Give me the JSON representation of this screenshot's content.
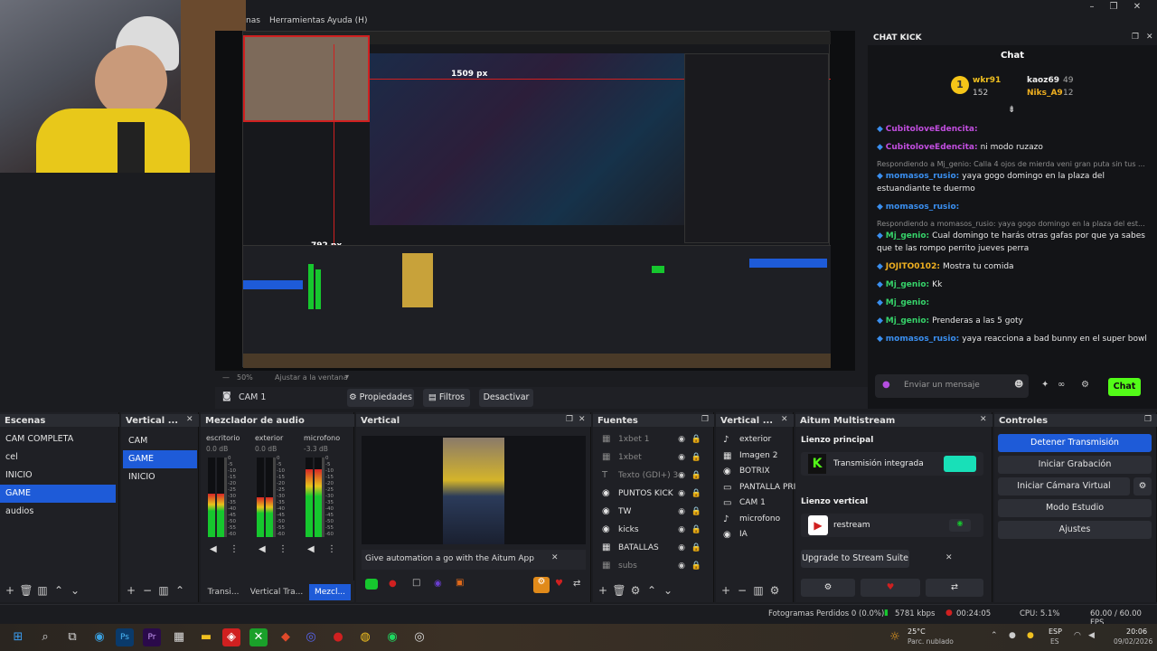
{
  "menu": {
    "items": [
      "nas",
      "Herramientas",
      "Ayuda (H)"
    ]
  },
  "preview": {
    "size_label_1": "1509 px",
    "size_label_2": "792 px",
    "zoom": "50%",
    "fit_label": "Ajustar a la ventana"
  },
  "source_toolbar": {
    "source_name": "CAM 1",
    "properties": "Propiedades",
    "filters": "Filtros",
    "deactivate": "Desactivar"
  },
  "chat": {
    "panel_title": "CHAT KICK",
    "header": "Chat",
    "leaderboard": [
      {
        "name": "wkr91",
        "count": "152"
      },
      {
        "name": "kaoz69",
        "count": "49"
      },
      {
        "name": "Niks_A9",
        "count": "12"
      }
    ],
    "messages": [
      {
        "user": "CubitoloveEdencita:",
        "text": "",
        "user_color": "#c24ee0"
      },
      {
        "user": "CubitoloveEdencita:",
        "text": "ni modo ruzazo",
        "user_color": "#c24ee0"
      },
      {
        "reply": "Respondiendo a Mj_genio: Calla 4 ojos de mierda veni gran puta sin tus ..."
      },
      {
        "user": "momasos_rusio:",
        "text": "yaya gogo domingo en la plaza del estuandiante te duermo",
        "user_color": "#3a8ff0"
      },
      {
        "user": "momasos_rusio:",
        "text": "",
        "user_color": "#3a8ff0"
      },
      {
        "reply": "Respondiendo a momasos_rusio: yaya gogo domingo en la plaza del est..."
      },
      {
        "user": "Mj_genio:",
        "text": "Cual domingo te harás otras gafas por que ya sabes que te las rompo perrito jueves perra",
        "user_color": "#36d36a"
      },
      {
        "user": "JOJITO0102:",
        "text": "Mostra tu comida",
        "user_color": "#f0b020"
      },
      {
        "user": "Mj_genio:",
        "text": "Kk",
        "user_color": "#36d36a"
      },
      {
        "user": "Mj_genio:",
        "text": "",
        "user_color": "#36d36a"
      },
      {
        "user": "Mj_genio:",
        "text": "Prenderas a las 5 goty",
        "user_color": "#36d36a"
      },
      {
        "user": "momasos_rusio:",
        "text": "yaya reacciona a bad bunny en el super bowl",
        "user_color": "#3a8ff0"
      }
    ],
    "input_placeholder": "Enviar un mensaje",
    "send_label": "Chat"
  },
  "scenes": {
    "title": "Escenas",
    "items": [
      "CAM COMPLETA",
      "cel",
      "INICIO",
      "GAME",
      "audios"
    ],
    "selected": 3
  },
  "vertical_scenes": {
    "title": "Vertical ...",
    "items": [
      "CAM",
      "GAME",
      "INICIO"
    ],
    "selected": 1
  },
  "mixer": {
    "title": "Mezclador de audio",
    "channels": [
      {
        "name": "escritorio",
        "db": "0.0 dB",
        "level": 0.55
      },
      {
        "name": "exterior",
        "db": "0.0 dB",
        "level": 0.5
      },
      {
        "name": "microfono",
        "db": "-3.3 dB",
        "level": 0.85
      }
    ],
    "ticks": [
      "0",
      "-5",
      "-10",
      "-15",
      "-20",
      "-25",
      "-30",
      "-35",
      "-40",
      "-45",
      "-50",
      "-55",
      "-60"
    ]
  },
  "vertical_preview": {
    "title": "Vertical",
    "banner": "Give automation a go with the Aitum App"
  },
  "sources": {
    "title": "Fuentes",
    "items": [
      {
        "name": "1xbet 1",
        "dim": true,
        "icon": "▦"
      },
      {
        "name": "1xbet",
        "dim": true,
        "icon": "▦"
      },
      {
        "name": "Texto (GDI+) 3",
        "dim": true,
        "icon": "T"
      },
      {
        "name": "PUNTOS KICK",
        "dim": false,
        "icon": "◉"
      },
      {
        "name": "TW",
        "dim": false,
        "icon": "◉"
      },
      {
        "name": "kicks",
        "dim": false,
        "icon": "◉"
      },
      {
        "name": "BATALLAS",
        "dim": false,
        "icon": "▦"
      },
      {
        "name": "subs",
        "dim": true,
        "icon": "▦"
      }
    ]
  },
  "vertical_sources": {
    "title": "Vertical ...",
    "items": [
      {
        "name": "exterior",
        "icon": "♪"
      },
      {
        "name": "Imagen 2",
        "icon": "▦"
      },
      {
        "name": "BOTRIX",
        "icon": "◉"
      },
      {
        "name": "PANTALLA PRIN",
        "icon": "▭"
      },
      {
        "name": "CAM 1",
        "icon": "▭"
      },
      {
        "name": "microfono",
        "icon": "♪"
      },
      {
        "name": "IA",
        "icon": "◉"
      }
    ]
  },
  "multistream": {
    "title": "Aitum Multistream",
    "main_canvas": "Lienzo principal",
    "main_target": "Transmisión integrada",
    "vertical_canvas": "Lienzo vertical",
    "vertical_target": "restream",
    "upgrade": "Upgrade to Stream Suite"
  },
  "controls": {
    "title": "Controles",
    "buttons": [
      "Detener Transmisión",
      "Iniciar Grabación",
      "Iniciar Cámara Virtual",
      "Modo Estudio",
      "Ajustes"
    ]
  },
  "dock_tabs": [
    "Transi...",
    "Vertical Tra...",
    "Mezcl..."
  ],
  "status": {
    "dropped": "Fotogramas Perdidos 0 (0.0%)",
    "bitrate": "5781 kbps",
    "time": "00:24:05",
    "cpu": "CPU: 5.1%",
    "fps": "60.00 / 60.00 FPS"
  },
  "taskbar": {
    "weather_temp": "25°C",
    "weather_desc": "Parc. nublado",
    "lang": "ESP",
    "lang2": "ES",
    "clock_time": "20:06",
    "clock_date": "09/02/2026"
  },
  "colors": {
    "accent": "#1e5bd8",
    "kick_green": "#53fc18",
    "meter_green": "#16c72e"
  }
}
